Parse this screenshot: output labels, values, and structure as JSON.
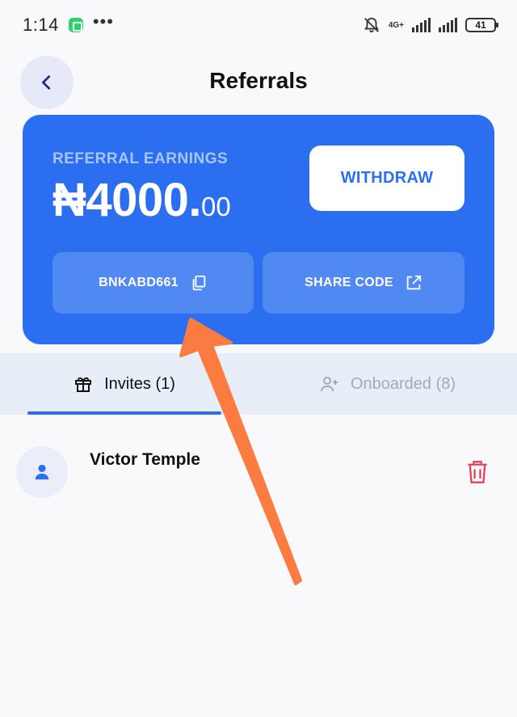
{
  "status_bar": {
    "time": "1:14",
    "more": "•••",
    "network": "4G+",
    "battery": "41"
  },
  "header": {
    "title": "Referrals",
    "back_icon": "chevron-left-icon"
  },
  "earnings_card": {
    "label": "REFERRAL EARNINGS",
    "amount_main": "₦4000.",
    "amount_cents": "00",
    "withdraw_label": "WITHDRAW",
    "referral_code": "BNKABD661",
    "copy_icon": "copy-icon",
    "share_label": "SHARE CODE",
    "share_icon": "external-link-icon",
    "card_color": "#2b6ff0"
  },
  "tabs": [
    {
      "label": "Invites (1)",
      "icon": "gift-icon",
      "active": true
    },
    {
      "label": "Onboarded (8)",
      "icon": "user-plus-icon",
      "active": false
    }
  ],
  "invites": [
    {
      "name": "Victor Temple",
      "avatar_icon": "user-icon",
      "delete_icon": "trash-icon"
    }
  ],
  "colors": {
    "accent": "#2b6ff0",
    "danger": "#e0445a",
    "annotation_arrow": "#fb7b40"
  }
}
